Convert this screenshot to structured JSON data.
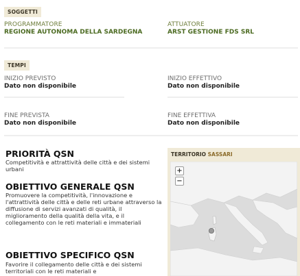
{
  "soggetti": {
    "tag": "SOGGETTI",
    "programmatore_label": "PROGRAMMATORE",
    "programmatore_value": "REGIONE AUTONOMA DELLA SARDEGNA",
    "attuatore_label": "ATTUATORE",
    "attuatore_value": "ARST GESTIONE FDS SRL"
  },
  "tempi": {
    "tag": "TEMPI",
    "inizio_previsto_label": "INIZIO PREVISTO",
    "inizio_previsto_value": "Dato non disponibile",
    "inizio_effettivo_label": "INIZIO EFFETTIVO",
    "inizio_effettivo_value": "Dato non disponibile",
    "fine_prevista_label": "FINE PREVISTA",
    "fine_prevista_value": "Dato non disponibile",
    "fine_effettiva_label": "FINE EFFETTIVA",
    "fine_effettiva_value": "Dato non disponibile"
  },
  "qsn": {
    "priorita_title": "PRIORITÀ QSN",
    "priorita_text": "Competitività e attrattività delle città e dei sistemi urbani",
    "obiettivo_generale_title": "OBIETTIVO GENERALE QSN",
    "obiettivo_generale_text": "Promuovere la competitività, l'innovazione e l'attrattività delle città e delle reti urbane attraverso la diffusione di servizi avanzati di qualità, il miglioramento della qualità della vita, e il collegamento con le reti materiali e immateriali",
    "obiettivo_specifico_title": "OBIETTIVO SPECIFICO QSN",
    "obiettivo_specifico_text": "Favorire il collegamento delle città e dei sistemi territoriali con le reti materiali e"
  },
  "territorio": {
    "label": "TERRITORIO",
    "city": "SASSARI",
    "zoom_in": "+",
    "zoom_out": "−"
  }
}
